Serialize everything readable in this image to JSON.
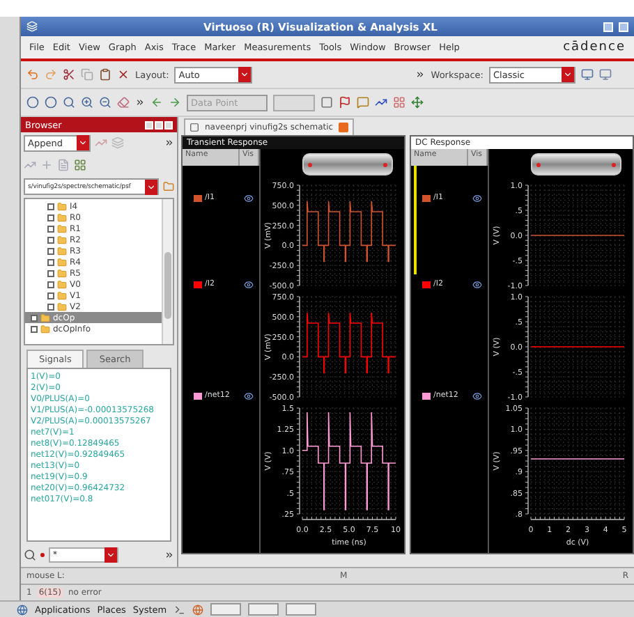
{
  "window": {
    "title": "Virtuoso (R) Visualization & Analysis XL"
  },
  "menu": [
    "File",
    "Edit",
    "View",
    "Graph",
    "Axis",
    "Trace",
    "Marker",
    "Measurements",
    "Tools",
    "Window",
    "Browser",
    "Help"
  ],
  "logo": "cādence",
  "toolbar": {
    "layout_label": "Layout:",
    "layout_value": "Auto",
    "workspace_label": "Workspace:",
    "workspace_value": "Classic",
    "data_point": {
      "value": "Data Point",
      "disabled": true
    }
  },
  "browser": {
    "title": "Browser",
    "mode": "Append",
    "path": "s/vinufig2s/spectre/schematic/psf",
    "tree": [
      {
        "children": [
          {
            "label": "I4",
            "selected": false
          },
          {
            "label": "R0",
            "selected": false
          },
          {
            "label": "R1",
            "selected": false
          },
          {
            "label": "R2",
            "selected": false
          },
          {
            "label": "R3",
            "selected": false
          },
          {
            "label": "R4",
            "selected": false
          },
          {
            "label": "R5",
            "selected": false
          },
          {
            "label": "V0",
            "selected": false
          },
          {
            "label": "V1",
            "selected": false
          },
          {
            "label": "V2",
            "selected": false
          }
        ]
      },
      {
        "label": "dcOp",
        "selected": true
      },
      {
        "label": "dcOpInfo",
        "selected": false
      }
    ],
    "tabs": [
      {
        "label": "Signals",
        "selected": true
      },
      {
        "label": "Search",
        "selected": false
      }
    ],
    "signals": [
      "1(V)=0",
      "2(V)=0",
      "V0/PLUS(A)=0",
      "V1/PLUS(A)=-0.00013575268",
      "V2/PLUS(A)=0.00013575267",
      "net7(V)=1",
      "net8(V)=0.12849465",
      "net12(V)=0.92849465",
      "net13(V)=0",
      "net19(V)=0.9",
      "net20(V)=0.96424732",
      "net017(V)=0.8"
    ],
    "filter": "*"
  },
  "document_tab": {
    "label": "naveenprj vinufig2s schematic"
  },
  "panels": [
    {
      "title": "Transient Response",
      "selected": false,
      "columns": [
        "Name",
        "Vis"
      ],
      "strips": [
        {
          "selected": false,
          "visible": true,
          "chart_data": {
            "type": "line",
            "grid": true,
            "ylabel": "V (mV)",
            "xlim": [
              0,
              10
            ],
            "ylim": [
              -500,
              750
            ],
            "yticks": [
              {
                "value": 750,
                "label": "750.0"
              },
              {
                "value": 500,
                "label": "500.0"
              },
              {
                "value": 250,
                "label": "250.0"
              },
              {
                "value": 0,
                "label": "0.0"
              },
              {
                "value": -250,
                "label": "-250.0"
              },
              {
                "value": -500,
                "label": "-500.0"
              }
            ],
            "x": [
              0,
              0.5,
              0.5,
              0.6,
              1.7,
              1.7,
              2.3,
              2.3,
              2.35,
              2.35,
              2.8,
              2.8,
              2.9,
              4.0,
              4.0,
              4.6,
              4.6,
              4.65,
              4.65,
              5.1,
              5.1,
              5.2,
              6.3,
              6.3,
              6.9,
              6.9,
              6.95,
              6.95,
              7.4,
              7.4,
              7.5,
              8.6,
              8.6,
              9.2,
              9.2,
              9.25,
              9.25,
              10
            ],
            "series": [
              {
                "name": "/I1",
                "color": "#d2522e",
                "values": [
                  0,
                  0,
                  550,
                  420,
                  420,
                  0,
                  0,
                  -200,
                  -200,
                  0,
                  0,
                  550,
                  420,
                  420,
                  0,
                  0,
                  -200,
                  -200,
                  0,
                  0,
                  550,
                  420,
                  420,
                  0,
                  0,
                  -200,
                  -200,
                  0,
                  0,
                  550,
                  420,
                  420,
                  0,
                  0,
                  -200,
                  -200,
                  0,
                  0
                ]
              }
            ]
          }
        },
        {
          "selected": false,
          "visible": true,
          "chart_data": {
            "type": "line",
            "grid": true,
            "ylabel": "V (mV)",
            "xlim": [
              0,
              10
            ],
            "ylim": [
              -500,
              750
            ],
            "yticks": [
              {
                "value": 750,
                "label": "750.0"
              },
              {
                "value": 500,
                "label": "500.0"
              },
              {
                "value": 250,
                "label": "250.0"
              },
              {
                "value": 0,
                "label": "0.0"
              },
              {
                "value": -250,
                "label": "-250.0"
              },
              {
                "value": -500,
                "label": "-500.0"
              }
            ],
            "x": [
              0,
              0.5,
              0.5,
              0.6,
              1.7,
              1.7,
              2.3,
              2.3,
              2.35,
              2.35,
              2.8,
              2.8,
              2.9,
              4.0,
              4.0,
              4.6,
              4.6,
              4.65,
              4.65,
              5.1,
              5.1,
              5.2,
              6.3,
              6.3,
              6.9,
              6.9,
              6.95,
              6.95,
              7.4,
              7.4,
              7.5,
              8.6,
              8.6,
              9.2,
              9.2,
              9.25,
              9.25,
              10
            ],
            "series": [
              {
                "name": "/I2",
                "color": "#ff0000",
                "values": [
                  0,
                  0,
                  550,
                  420,
                  420,
                  0,
                  0,
                  -200,
                  -200,
                  0,
                  0,
                  550,
                  420,
                  420,
                  0,
                  0,
                  -200,
                  -200,
                  0,
                  0,
                  550,
                  420,
                  420,
                  0,
                  0,
                  -200,
                  -200,
                  0,
                  0,
                  550,
                  420,
                  420,
                  0,
                  0,
                  -200,
                  -200,
                  0,
                  0
                ]
              }
            ]
          }
        },
        {
          "selected": false,
          "visible": true,
          "chart_data": {
            "type": "line",
            "grid": true,
            "ylabel": "V (V)",
            "xlabel": "time (ns)",
            "xlim": [
              0,
              10
            ],
            "ylim": [
              0.25,
              1.5
            ],
            "yticks": [
              {
                "value": 1.5,
                "label": "1.5"
              },
              {
                "value": 1.25,
                "label": "1.25"
              },
              {
                "value": 1.0,
                "label": "1.0"
              },
              {
                "value": 0.75,
                "label": ".75"
              },
              {
                "value": 0.5,
                "label": ".5"
              },
              {
                "value": 0.25,
                "label": ".25"
              }
            ],
            "xticks": [
              {
                "value": 0,
                "label": "0.0"
              },
              {
                "value": 2.5,
                "label": "2.5"
              },
              {
                "value": 5,
                "label": "5.0"
              },
              {
                "value": 7.5,
                "label": "7.5"
              },
              {
                "value": 10,
                "label": "10"
              }
            ],
            "x": [
              0,
              0.5,
              0.5,
              0.6,
              1.7,
              1.7,
              2.3,
              2.3,
              2.35,
              2.35,
              2.8,
              2.8,
              2.9,
              4.0,
              4.0,
              4.6,
              4.6,
              4.65,
              4.65,
              5.1,
              5.1,
              5.2,
              6.3,
              6.3,
              6.9,
              6.9,
              6.95,
              6.95,
              7.4,
              7.4,
              7.5,
              8.6,
              8.6,
              9.2,
              9.2,
              9.25,
              9.25,
              10
            ],
            "series": [
              {
                "name": "/net12",
                "color": "#ff9ad5",
                "values": [
                  1.0,
                  1.0,
                  1.45,
                  1.05,
                  1.05,
                  0.85,
                  0.85,
                  0.3,
                  0.3,
                  0.85,
                  0.85,
                  1.45,
                  1.05,
                  1.05,
                  0.85,
                  0.85,
                  0.3,
                  0.3,
                  0.85,
                  0.85,
                  1.45,
                  1.05,
                  1.05,
                  0.85,
                  0.85,
                  0.3,
                  0.3,
                  0.85,
                  0.85,
                  1.45,
                  1.05,
                  1.05,
                  0.85,
                  0.85,
                  0.3,
                  0.3,
                  0.85,
                  0.85
                ]
              }
            ]
          }
        }
      ]
    },
    {
      "title": "DC Response",
      "selected": true,
      "columns": [
        "Name",
        "Vis"
      ],
      "strips": [
        {
          "selected": true,
          "visible": true,
          "chart_data": {
            "type": "line",
            "grid": true,
            "ylabel": "V (V)",
            "xlim": [
              0,
              5
            ],
            "ylim": [
              -1,
              1
            ],
            "yticks": [
              {
                "value": 1,
                "label": "1.0"
              },
              {
                "value": 0.5,
                "label": ".5"
              },
              {
                "value": 0,
                "label": "0.0"
              },
              {
                "value": -0.5,
                "label": "-.5"
              },
              {
                "value": -1,
                "label": "-1.0"
              }
            ],
            "x": [
              0,
              5
            ],
            "series": [
              {
                "name": "/I1",
                "color": "#d2522e",
                "values": [
                  0,
                  0
                ]
              }
            ]
          }
        },
        {
          "selected": false,
          "visible": true,
          "chart_data": {
            "type": "line",
            "grid": true,
            "ylabel": "V (V)",
            "xlim": [
              0,
              5
            ],
            "ylim": [
              -1,
              1
            ],
            "yticks": [
              {
                "value": 1,
                "label": "1.0"
              },
              {
                "value": 0.5,
                "label": ".5"
              },
              {
                "value": 0,
                "label": "0.0"
              },
              {
                "value": -0.5,
                "label": "-.5"
              },
              {
                "value": -1,
                "label": "-1.0"
              }
            ],
            "x": [
              0,
              5
            ],
            "series": [
              {
                "name": "/I2",
                "color": "#ff0000",
                "values": [
                  0,
                  0
                ]
              }
            ]
          }
        },
        {
          "selected": false,
          "visible": true,
          "chart_data": {
            "type": "line",
            "grid": true,
            "ylabel": "V (V)",
            "xlabel": "dc (V)",
            "xlim": [
              0,
              5
            ],
            "ylim": [
              0.8,
              1.05
            ],
            "yticks": [
              {
                "value": 1.05,
                "label": "1.05"
              },
              {
                "value": 1.0,
                "label": "1.0"
              },
              {
                "value": 0.95,
                "label": ".95"
              },
              {
                "value": 0.9,
                "label": ".9"
              },
              {
                "value": 0.85,
                "label": ".85"
              },
              {
                "value": 0.8,
                "label": ".8"
              }
            ],
            "xticks": [
              0,
              1,
              2,
              3,
              4,
              5
            ],
            "x": [
              0,
              5
            ],
            "series": [
              {
                "name": "/net12",
                "color": "#ff9ad5",
                "values": [
                  0.93,
                  0.93
                ]
              }
            ]
          }
        }
      ]
    }
  ],
  "status": {
    "mouse": "mouse L:",
    "middle": "M",
    "right": "R",
    "line": "1",
    "count": "6(15)",
    "message": "no error"
  },
  "taskbar": [
    "Applications",
    "Places",
    "System"
  ]
}
